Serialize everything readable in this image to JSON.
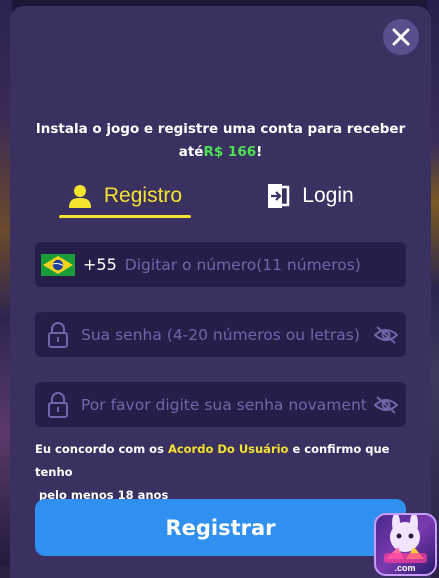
{
  "close_icon": "close-icon",
  "intro": {
    "line1": "Instala o jogo e registre uma conta para receber",
    "prefix": "até",
    "amount": "R$ 166",
    "suffix": "!"
  },
  "tabs": [
    {
      "label": "Registro",
      "icon": "user-icon",
      "active": true
    },
    {
      "label": "Login",
      "icon": "login-door-icon",
      "active": false
    }
  ],
  "phone": {
    "country_code": "+55",
    "flag": "brazil-flag-icon",
    "placeholder": "Digitar o número(11 números)",
    "value": ""
  },
  "password": {
    "placeholder": "Sua senha (4-20 números ou letras)",
    "value": ""
  },
  "confirm_password": {
    "placeholder": "Por favor digite sua senha novamente",
    "value": ""
  },
  "agreement": {
    "before": "Eu concordo com os ",
    "link": "Acordo Do Usuário",
    "after": " e confirmo que tenho",
    "line2": "pelo menos 18 anos"
  },
  "submit_label": "Registrar",
  "logo_text": ".com",
  "colors": {
    "accent_yellow": "#f4e22e",
    "amount_green": "#4be352",
    "button_blue": "#2f90f0",
    "modal_bg": "#3a3160",
    "field_bg": "#261e48"
  }
}
